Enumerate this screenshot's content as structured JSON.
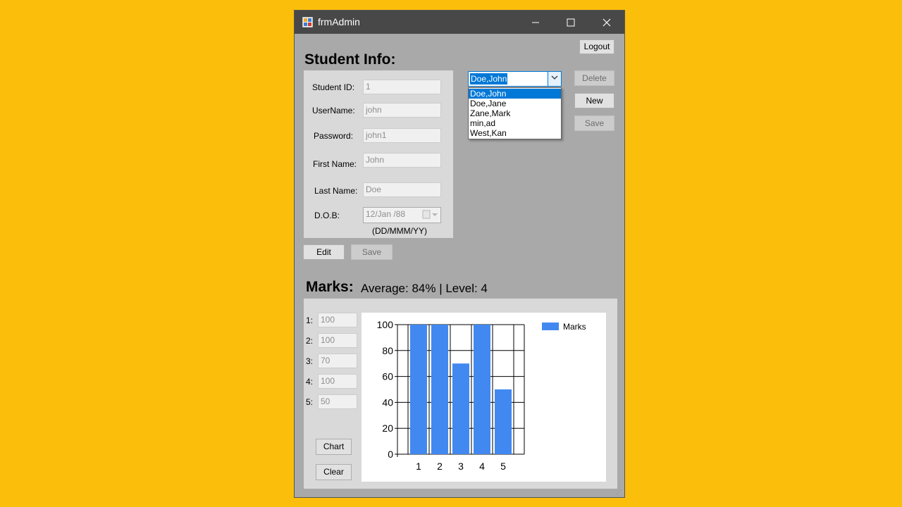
{
  "window": {
    "title": "frmAdmin",
    "app_icon": "winforms-app-icon",
    "minimize_glyph": "—",
    "maximize_glyph": "☐",
    "close_glyph": "✕"
  },
  "logout_label": "Logout",
  "student_info": {
    "heading": "Student Info:",
    "fields": {
      "student_id": {
        "label": "Student ID:",
        "value": "1"
      },
      "username": {
        "label": "UserName:",
        "value": "john"
      },
      "password": {
        "label": "Password:",
        "value": "john1"
      },
      "first_name": {
        "label": "First Name:",
        "value": "John"
      },
      "last_name": {
        "label": "Last Name:",
        "value": "Doe"
      },
      "dob": {
        "label": "D.O.B:",
        "value": "12/Jan /88",
        "hint": "(DD/MMM/YY)"
      }
    },
    "edit_label": "Edit",
    "save_label": "Save"
  },
  "student_select": {
    "selected": "Doe,John",
    "options": [
      "Doe,John",
      "Doe,Jane",
      "Zane,Mark",
      "min,ad",
      "West,Kan"
    ]
  },
  "record_buttons": {
    "delete": "Delete",
    "new": "New",
    "save": "Save"
  },
  "marks": {
    "heading": "Marks:",
    "summary": "Average: 84% | Level: 4",
    "fields": [
      {
        "label": "1:",
        "value": "100"
      },
      {
        "label": "2:",
        "value": "100"
      },
      {
        "label": "3:",
        "value": "70"
      },
      {
        "label": "4:",
        "value": "100"
      },
      {
        "label": "5:",
        "value": "50"
      }
    ],
    "chart_button": "Chart",
    "clear_button": "Clear"
  },
  "chart_data": {
    "type": "bar",
    "categories": [
      "1",
      "2",
      "3",
      "4",
      "5"
    ],
    "series": [
      {
        "name": "Marks",
        "values": [
          100,
          100,
          70,
          100,
          50
        ],
        "color": "#4189F1"
      }
    ],
    "ylim": [
      0,
      100
    ],
    "yticks": [
      0,
      20,
      40,
      60,
      80,
      100
    ],
    "grid": true,
    "legend": "top-right",
    "title": "",
    "xlabel": "",
    "ylabel": ""
  }
}
